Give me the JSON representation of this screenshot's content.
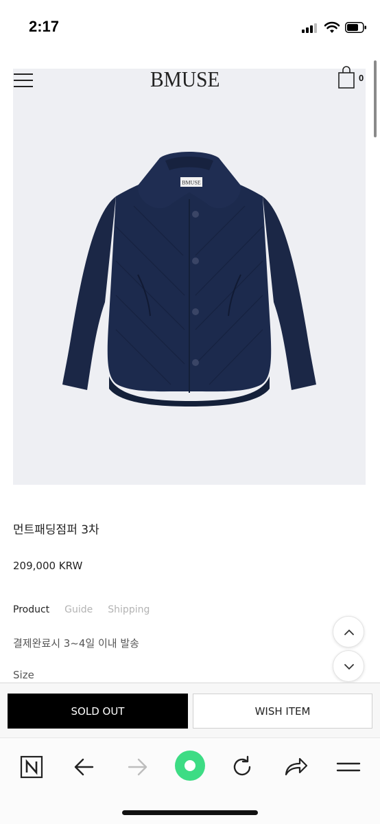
{
  "status_bar": {
    "time": "2:17"
  },
  "header": {
    "brand": "BMUSE",
    "cart_count": "0"
  },
  "product": {
    "image_label": "BMUSE",
    "name": "먼트패딩점퍼 3차",
    "price": "209,000 KRW"
  },
  "tabs": [
    {
      "label": "Product",
      "active": true
    },
    {
      "label": "Guide",
      "active": false
    },
    {
      "label": "Shipping",
      "active": false
    }
  ],
  "shipping_note": "결제완료시 3~4일 이내 발송",
  "size_label": "Size",
  "actions": {
    "sold_out": "SOLD OUT",
    "wish": "WISH ITEM"
  },
  "colors": {
    "accent": "#000000",
    "jacket": "#1c2a4d",
    "reload": "#3ddc84"
  },
  "browser_toolbar": [
    "naver-icon",
    "back-arrow-icon",
    "forward-arrow-icon",
    "green-dot-icon",
    "reload-icon",
    "share-icon",
    "menu-icon"
  ]
}
